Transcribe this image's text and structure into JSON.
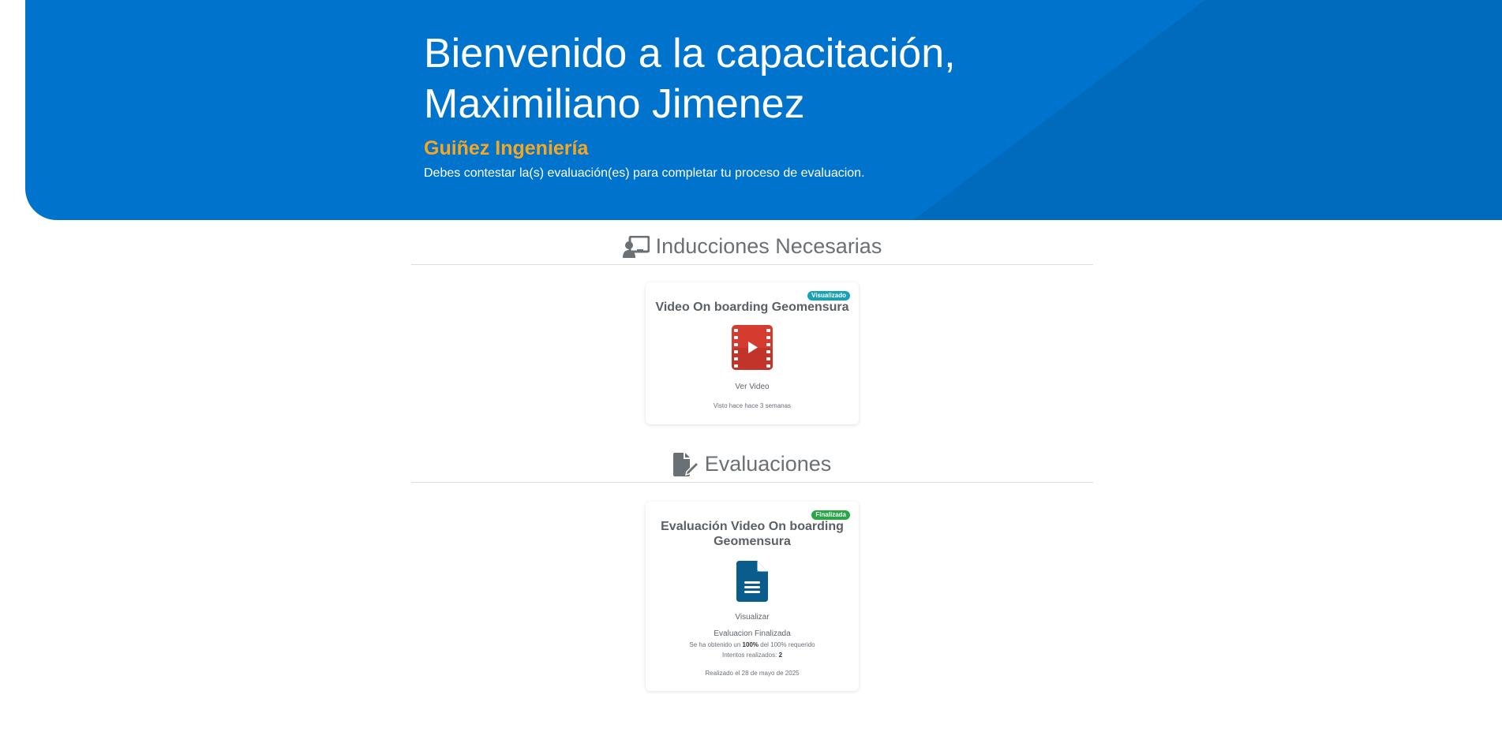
{
  "header": {
    "title_line1": "Bienvenido a la capacitación,",
    "title_line2": "Maximiliano Jimenez",
    "company": "Guiñez Ingeniería",
    "subtitle": "Debes contestar la(s) evaluación(es) para completar tu proceso de evaluacion."
  },
  "inducciones": {
    "heading": "Inducciones Necesarias",
    "icon": "chalkboard-teacher-icon",
    "card": {
      "badge": "Visualizado",
      "badge_color": "#17a2b8",
      "title": "Video On boarding Geomensura",
      "icon": "video-film-icon",
      "icon_color": "#d63b2f",
      "action": "Ver Video",
      "seen": "Visto hace hace 3 semanas"
    }
  },
  "evaluaciones": {
    "heading": "Evaluaciones",
    "icon": "file-signature-icon",
    "card": {
      "badge": "Finalizada",
      "badge_color": "#28a745",
      "title": "Evaluación Video On boarding Geomensura",
      "icon": "document-icon",
      "icon_color": "#0a5c8c",
      "action": "Visualizar",
      "status": "Evaluacion Finalizada",
      "score_prefix": "Se ha obtenido un ",
      "score_value": "100%",
      "score_suffix": " del 100% requerido",
      "attempts_label": "Intentos realizados: ",
      "attempts_value": "2",
      "date": "Realizado el 28 de mayo de 2025"
    }
  },
  "colors": {
    "hero_bg": "#0074cc",
    "company": "#f5a623"
  }
}
